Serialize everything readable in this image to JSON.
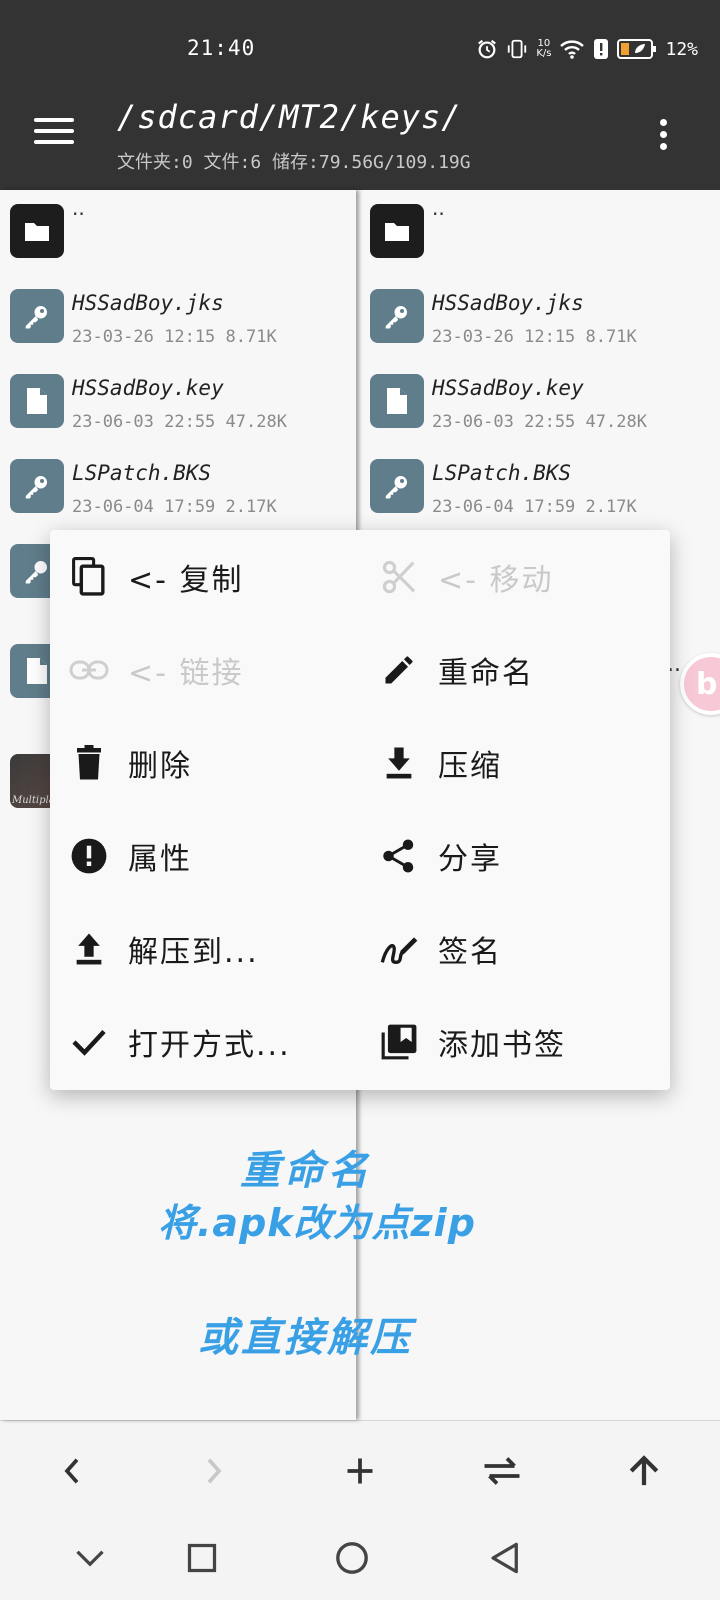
{
  "status_bar": {
    "time": "21:40",
    "net_speed_value": "10",
    "net_speed_unit": "K/s",
    "battery_pct": "12%"
  },
  "header": {
    "path": "/sdcard/MT2/keys/",
    "info": "文件夹:0  文件:6  储存:79.56G/109.19G"
  },
  "left_pane": {
    "files": [
      {
        "name": "..",
        "meta": "",
        "icon": "folder-icon"
      },
      {
        "name": "HSSadBoy.jks",
        "meta": "23-03-26 12:15  8.71K",
        "icon": "key-icon"
      },
      {
        "name": "HSSadBoy.key",
        "meta": "23-06-03 22:55  47.28K",
        "icon": "file-icon"
      },
      {
        "name": "LSPatch.BKS",
        "meta": "23-06-04 17:59  2.17K",
        "icon": "key-icon"
      }
    ],
    "image_thumb_label": "Multipla"
  },
  "right_pane": {
    "files": [
      {
        "name": "..",
        "meta": "",
        "icon": "folder-icon"
      },
      {
        "name": "HSSadBoy.jks",
        "meta": "23-03-26 12:15  8.71K",
        "icon": "key-icon"
      },
      {
        "name": "HSSadBoy.key",
        "meta": "23-06-03 22:55  47.28K",
        "icon": "file-icon"
      },
      {
        "name": "LSPatch.BKS",
        "meta": "23-06-04 17:59  2.17K",
        "icon": "key-icon"
      }
    ],
    "partial_name_suffix": "..."
  },
  "floating_bubble": {
    "glyph": "b"
  },
  "context_menu": {
    "copy": "<- 复制",
    "move": "<- 移动",
    "link": "<- 链接",
    "rename": "重命名",
    "delete": "删除",
    "compress": "压缩",
    "properties": "属性",
    "share": "分享",
    "extract_to": "解压到...",
    "sign": "签名",
    "open_with": "打开方式...",
    "add_bookmark": "添加书签"
  },
  "annotation": {
    "line1": "重命名",
    "line2": "将.apk改为点zip",
    "line3": "或直接解压"
  },
  "colors": {
    "header_bg": "#333333",
    "key_icon_bg": "#607d8b",
    "folder_icon_bg": "#1d1d1d",
    "annotation": "#3aa0e6",
    "disabled": "#c9c9c9"
  }
}
